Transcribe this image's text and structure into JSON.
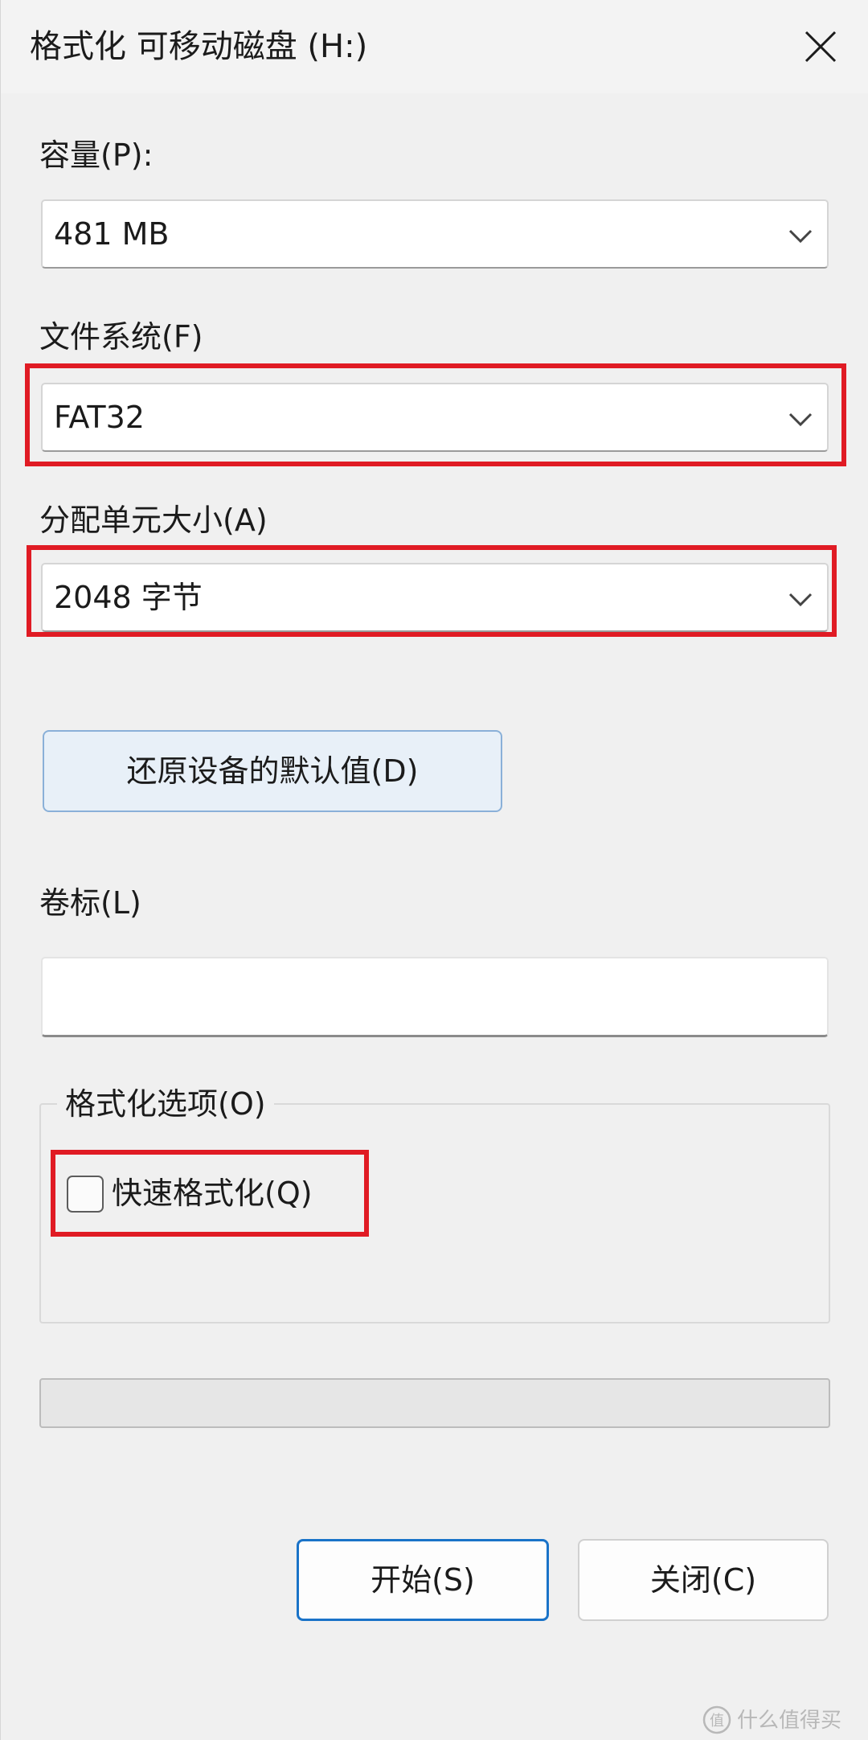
{
  "window": {
    "title": "格式化 可移动磁盘 (H:)",
    "close_icon": "close-icon"
  },
  "capacity": {
    "label": "容量(P):",
    "value": "481 MB"
  },
  "file_system": {
    "label": "文件系统(F)",
    "value": "FAT32"
  },
  "allocation_unit": {
    "label": "分配单元大小(A)",
    "value": "2048 字节"
  },
  "restore_defaults": {
    "label": "还原设备的默认值(D)"
  },
  "volume_label": {
    "label": "卷标(L)",
    "value": ""
  },
  "format_options": {
    "legend": "格式化选项(O)",
    "quick_format": {
      "label": "快速格式化(Q)",
      "checked": false
    }
  },
  "progress": {
    "value": 0
  },
  "buttons": {
    "start": "开始(S)",
    "close": "关闭(C)"
  },
  "watermark": {
    "text": "值 什么值得买"
  },
  "colors": {
    "highlight": "#e01b24",
    "primary_border": "#1a73c8",
    "restore_bg": "#e8f0f8"
  }
}
